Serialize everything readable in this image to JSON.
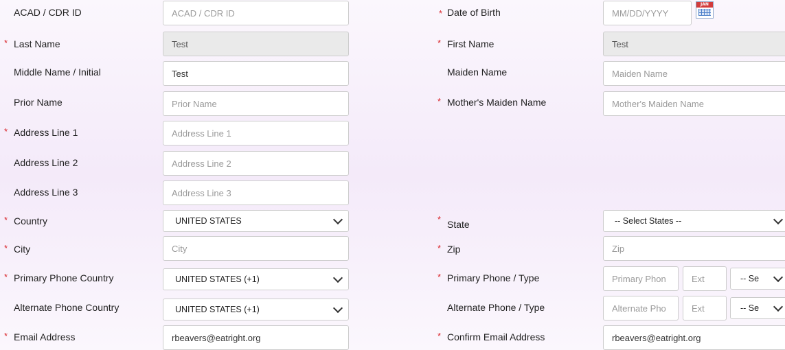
{
  "left": {
    "acad": {
      "label": "ACAD / CDR ID",
      "placeholder": "ACAD / CDR ID",
      "value": ""
    },
    "last_name": {
      "label": "Last Name",
      "value": "Test"
    },
    "middle_name": {
      "label": "Middle Name / Initial",
      "value": "Test"
    },
    "prior_name": {
      "label": "Prior Name",
      "placeholder": "Prior Name"
    },
    "address1": {
      "label": "Address Line 1",
      "placeholder": "Address Line 1"
    },
    "address2": {
      "label": "Address Line 2",
      "placeholder": "Address Line 2"
    },
    "address3": {
      "label": "Address Line 3",
      "placeholder": "Address Line 3"
    },
    "country": {
      "label": "Country",
      "value": "UNITED STATES"
    },
    "city": {
      "label": "City",
      "placeholder": "City"
    },
    "primary_phone_country": {
      "label": "Primary Phone Country",
      "value": "UNITED STATES (+1)"
    },
    "alternate_phone_country": {
      "label": "Alternate Phone Country",
      "value": "UNITED STATES (+1)"
    },
    "email": {
      "label": "Email Address",
      "value": "rbeavers@eatright.org"
    }
  },
  "right": {
    "dob": {
      "label": "Date of Birth",
      "placeholder": "MM/DD/YYYY",
      "calendar_icon": "calendar-icon",
      "calendar_text": "JAN"
    },
    "first_name": {
      "label": "First Name",
      "value": "Test"
    },
    "maiden_name": {
      "label": "Maiden Name",
      "placeholder": "Maiden Name"
    },
    "mothers_maiden_name": {
      "label": "Mother's Maiden Name",
      "placeholder": "Mother's Maiden Name"
    },
    "state": {
      "label": "State",
      "value": "-- Select States --"
    },
    "zip": {
      "label": "Zip",
      "placeholder": "Zip"
    },
    "primary_phone": {
      "label": "Primary Phone / Type",
      "placeholder": "Primary Phon",
      "ext_placeholder": "Ext",
      "type_value": "-- Se"
    },
    "alternate_phone": {
      "label": "Alternate Phone / Type",
      "placeholder": "Alternate Pho",
      "ext_placeholder": "Ext",
      "type_value": "-- Se"
    },
    "confirm_email": {
      "label": "Confirm Email Address",
      "value": "rbeavers@eatright.org"
    }
  },
  "required_marker": "*",
  "colors": {
    "required": "#d9262b",
    "background": "#f4eaf9",
    "disabled_field": "#eaeaea"
  }
}
